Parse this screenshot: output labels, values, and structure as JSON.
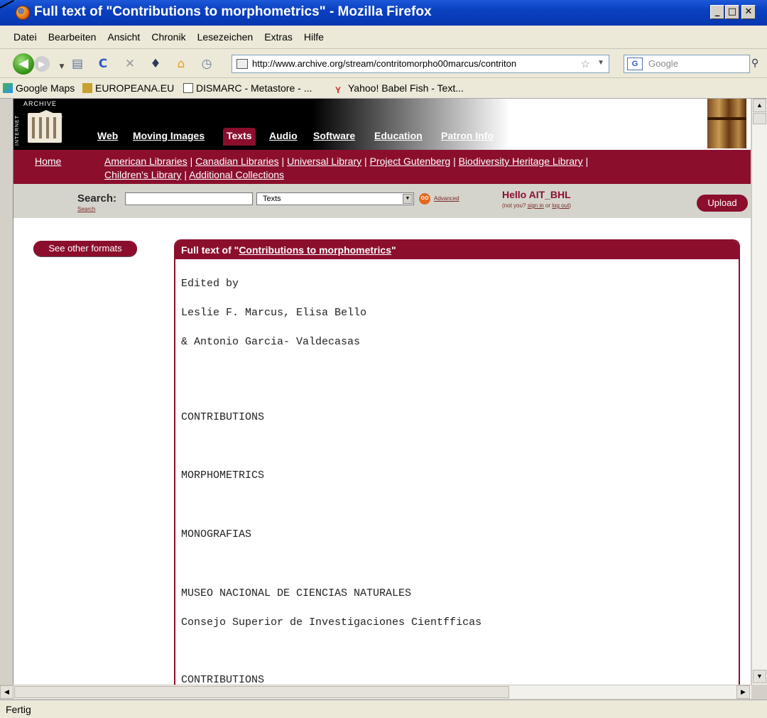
{
  "window": {
    "title": "Full text of \"Contributions to morphometrics\" - Mozilla Firefox"
  },
  "menu": [
    "Datei",
    "Bearbeiten",
    "Ansicht",
    "Chronik",
    "Lesezeichen",
    "Extras",
    "Hilfe"
  ],
  "nav": {
    "url": "http://www.archive.org/stream/contritomorpho00marcus/contriton",
    "search_placeholder": "Google"
  },
  "bookmarks": [
    "Google Maps",
    "EUROPEANA.EU",
    "DISMARC - Metastore - ...",
    "Yahoo! Babel Fish - Text..."
  ],
  "ia": {
    "logo_vertical": "INTERNET",
    "logo_top": "ARCHIVE",
    "tabs": [
      "Web",
      "Moving Images",
      "Texts",
      "Audio",
      "Software",
      "Education",
      "Patron Info"
    ],
    "home": "Home",
    "collections_row1": [
      "American Libraries",
      "Canadian Libraries",
      "Universal Library",
      "Project Gutenberg",
      "Biodiversity Heritage Library"
    ],
    "collections_row2": [
      "Children's Library",
      "Additional Collections"
    ],
    "search_label": "Search:",
    "search_small": "Search",
    "search_select": "Texts",
    "go_label": "GO",
    "advanced": "Advanced",
    "hello": "Hello AIT_BHL",
    "not_you_prefix": "(not you? ",
    "sign_in": "sign in",
    "or_text": " or ",
    "log_out": "log out",
    "not_you_suffix": ")",
    "upload": "Upload",
    "see_formats": "See other formats",
    "fulltext_prefix": "Full text of \"",
    "fulltext_title": "Contributions to morphometrics",
    "fulltext_suffix": "\""
  },
  "fulltext_lines": [
    "Edited by",
    "Leslie F. Marcus, Elisa Bello",
    "& Antonio Garcia- Valdecasas",
    "CONTRIBUTIONS",
    "MORPHOMETRICS",
    "MONOGRAFIAS",
    "MUSEO NACIONAL DE CIENCIAS NATURALES",
    "Consejo Superior de Investigaciones Cientfficas",
    "CONTRIBUTIONS"
  ],
  "status": "Fertig"
}
